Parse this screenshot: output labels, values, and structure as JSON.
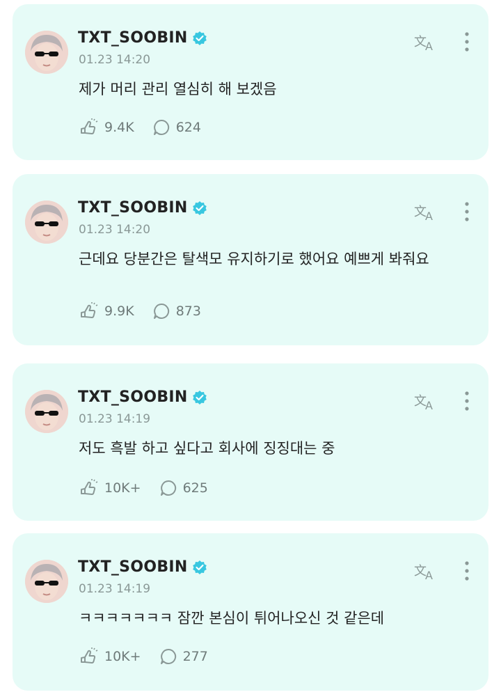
{
  "posts": [
    {
      "author": "TXT_SOOBIN",
      "time": "01.23 14:20",
      "text": "제가 머리 관리 열심히 해 보겠음",
      "likes": "9.4K",
      "comments": "624"
    },
    {
      "author": "TXT_SOOBIN",
      "time": "01.23 14:20",
      "text": "근데요 당분간은 탈색모 유지하기로 했어요 예쁘게 봐줘요",
      "likes": "9.9K",
      "comments": "873"
    },
    {
      "author": "TXT_SOOBIN",
      "time": "01.23 14:19",
      "text": "저도 흑발 하고 싶다고 회사에 징징대는 중",
      "likes": "10K+",
      "comments": "625"
    },
    {
      "author": "TXT_SOOBIN",
      "time": "01.23 14:19",
      "text": "ㅋㅋㅋㅋㅋㅋㅋ 잠깐 본심이 튀어나오신 것 같은데",
      "likes": "10K+",
      "comments": "277"
    }
  ],
  "colors": {
    "card_background": "#e6fbf7",
    "verified_badge": "#38c7e0",
    "secondary_text": "#8a9896",
    "icon_gray": "#8a9896"
  },
  "icons": {
    "like": "like-icon",
    "comment": "comment-icon",
    "translate": "translate-icon",
    "more": "more-vertical-icon",
    "verified": "verified-badge-icon"
  }
}
